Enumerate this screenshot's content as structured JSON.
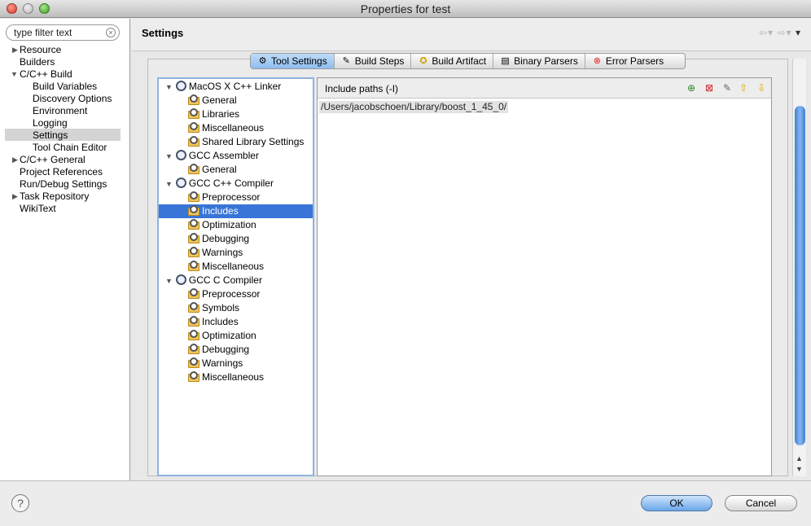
{
  "window": {
    "title": "Properties for test"
  },
  "sidebar": {
    "filter_placeholder": "type filter text",
    "items": [
      {
        "label": "Resource"
      },
      {
        "label": "Builders"
      },
      {
        "label": "C/C++ Build"
      },
      {
        "label": "Build Variables"
      },
      {
        "label": "Discovery Options"
      },
      {
        "label": "Environment"
      },
      {
        "label": "Logging"
      },
      {
        "label": "Settings"
      },
      {
        "label": "Tool Chain Editor"
      },
      {
        "label": "C/C++ General"
      },
      {
        "label": "Project References"
      },
      {
        "label": "Run/Debug Settings"
      },
      {
        "label": "Task Repository"
      },
      {
        "label": "WikiText"
      }
    ],
    "selected": "Settings"
  },
  "header": {
    "title": "Settings"
  },
  "tabs": [
    {
      "label": "Tool Settings",
      "icon": "tool-settings-icon"
    },
    {
      "label": "Build Steps",
      "icon": "build-steps-icon"
    },
    {
      "label": "Build Artifact",
      "icon": "build-artifact-icon"
    },
    {
      "label": "Binary Parsers",
      "icon": "binary-parsers-icon"
    },
    {
      "label": "Error Parsers",
      "icon": "error-parsers-icon"
    }
  ],
  "tree": {
    "items": [
      {
        "label": "MacOS X C++ Linker"
      },
      {
        "label": "General"
      },
      {
        "label": "Libraries"
      },
      {
        "label": "Miscellaneous"
      },
      {
        "label": "Shared Library Settings"
      },
      {
        "label": "GCC Assembler"
      },
      {
        "label": "General"
      },
      {
        "label": "GCC C++ Compiler"
      },
      {
        "label": "Preprocessor"
      },
      {
        "label": "Includes"
      },
      {
        "label": "Optimization"
      },
      {
        "label": "Debugging"
      },
      {
        "label": "Warnings"
      },
      {
        "label": "Miscellaneous"
      },
      {
        "label": "GCC C Compiler"
      },
      {
        "label": "Preprocessor"
      },
      {
        "label": "Symbols"
      },
      {
        "label": "Includes"
      },
      {
        "label": "Optimization"
      },
      {
        "label": "Debugging"
      },
      {
        "label": "Warnings"
      },
      {
        "label": "Miscellaneous"
      }
    ],
    "selected": "Includes"
  },
  "content": {
    "title": "Include paths (-I)",
    "paths": [
      "/Users/jacobschoen/Library/boost_1_45_0/"
    ]
  },
  "footer": {
    "ok_label": "OK",
    "cancel_label": "Cancel",
    "help_symbol": "?"
  }
}
